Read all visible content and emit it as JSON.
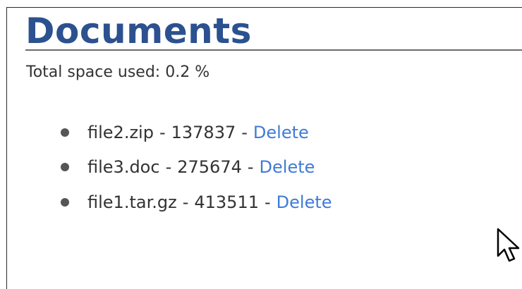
{
  "page": {
    "title": "Documents",
    "usage_label": "Total space used:",
    "usage_value": "0.2 %"
  },
  "files": [
    {
      "name": "file2.zip",
      "size": "137837",
      "action": "Delete"
    },
    {
      "name": "file3.doc",
      "size": "275674",
      "action": "Delete"
    },
    {
      "name": "file1.tar.gz",
      "size": "413511",
      "action": "Delete"
    }
  ],
  "separator": "-",
  "colors": {
    "title": "#2c5190",
    "link": "#3f7bd6",
    "text": "#333333"
  },
  "icons": {
    "cursor": "mouse-pointer-icon"
  }
}
